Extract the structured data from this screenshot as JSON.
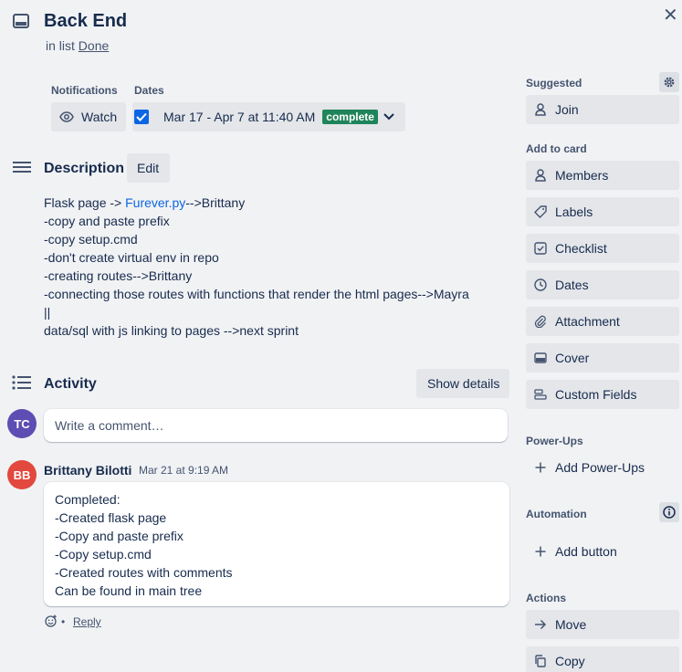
{
  "card": {
    "title": "Back End",
    "in_list_prefix": "in list",
    "list_name": "Done",
    "close_symbol": "✕"
  },
  "notifications": {
    "label": "Notifications",
    "watch_label": "Watch"
  },
  "dates": {
    "label": "Dates",
    "range": "Mar 17 - Apr 7 at 11:40 AM",
    "status": "complete",
    "checked": true
  },
  "description": {
    "title": "Description",
    "edit_label": "Edit",
    "line1_prefix": "Flask page -> ",
    "line1_link": "Furever.py",
    "line1_suffix": "-->Brittany",
    "lines": [
      "-copy and paste prefix",
      "-copy setup.cmd",
      "-don't create virtual env in repo",
      "-creating routes-->Brittany",
      "-connecting those routes with functions that render the html pages-->Mayra",
      "||",
      "data/sql with js linking to pages -->next sprint"
    ]
  },
  "activity": {
    "title": "Activity",
    "show_details_label": "Show details",
    "current_user_initials": "TC",
    "comment_placeholder": "Write a comment…",
    "comment": {
      "author_initials": "BB",
      "author": "Brittany Bilotti",
      "timestamp": "Mar 21 at 9:19 AM",
      "lines": [
        "Completed:",
        "-Created flask page",
        "-Copy and paste prefix",
        "-Copy setup.cmd",
        "-Created routes with comments",
        "Can be found in main tree"
      ],
      "separator": "•",
      "reply_label": "Reply"
    }
  },
  "sidebar": {
    "suggested": {
      "label": "Suggested",
      "join": "Join"
    },
    "add_to_card": {
      "label": "Add to card",
      "items": [
        "Members",
        "Labels",
        "Checklist",
        "Dates",
        "Attachment",
        "Cover",
        "Custom Fields"
      ]
    },
    "power_ups": {
      "label": "Power-Ups",
      "add": "Add Power-Ups"
    },
    "automation": {
      "label": "Automation",
      "add_button": "Add button"
    },
    "actions": {
      "label": "Actions",
      "items": [
        "Move",
        "Copy"
      ]
    }
  },
  "colors": {
    "tc_avatar": "#5e4db2",
    "bb_avatar": "#e2483d",
    "complete_badge": "#1f845a",
    "checkbox": "#0c66e4",
    "link": "#0c66e4"
  }
}
